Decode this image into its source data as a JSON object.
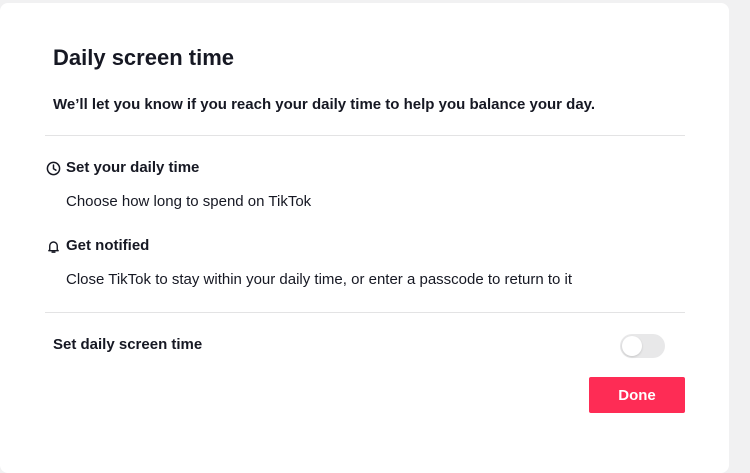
{
  "modal": {
    "title": "Daily screen time",
    "subtitle": "We’ll let you know if you reach your daily time to help you balance your day."
  },
  "sections": [
    {
      "icon": "clock-icon",
      "heading": "Set your daily time",
      "description": "Choose how long to spend on TikTok"
    },
    {
      "icon": "bell-icon",
      "heading": "Get notified",
      "description": "Close TikTok to stay within your daily time, or enter a passcode to return to it"
    }
  ],
  "setting": {
    "label": "Set daily screen time",
    "enabled": false
  },
  "actions": {
    "done_label": "Done"
  },
  "colors": {
    "accent": "#fe2c55",
    "text": "#161823",
    "divider": "#e3e3e4",
    "toggle_off": "#e8e8e9"
  }
}
